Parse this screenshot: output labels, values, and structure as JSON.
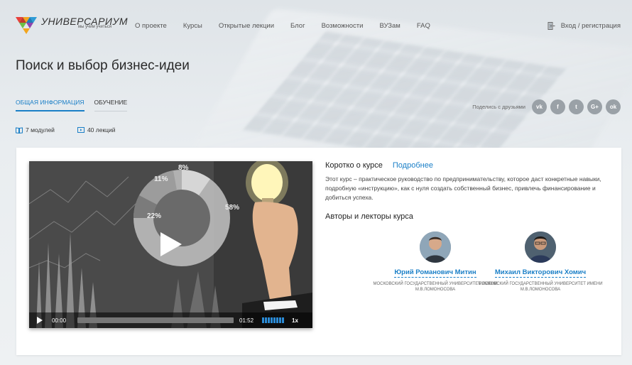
{
  "brand": {
    "name": "УНИВЕРСАРИУМ",
    "tagline": "мы учим учиться"
  },
  "nav": {
    "items": [
      "О проекте",
      "Курсы",
      "Открытые лекции",
      "Блог",
      "Возможности",
      "ВУЗам",
      "FAQ"
    ]
  },
  "login": {
    "label": "Вход / регистрация",
    "icon": "door-icon"
  },
  "page": {
    "title": "Поиск и выбор бизнес-идеи"
  },
  "tabs": [
    {
      "label": "Общая информация",
      "active": true
    },
    {
      "label": "Обучение",
      "active": false
    }
  ],
  "share": {
    "label": "Поделись с друзьями",
    "networks": [
      {
        "name": "vk-icon",
        "glyph": "vk"
      },
      {
        "name": "facebook-icon",
        "glyph": "f"
      },
      {
        "name": "twitter-icon",
        "glyph": "t"
      },
      {
        "name": "google-plus-icon",
        "glyph": "G+"
      },
      {
        "name": "odnoklassniki-icon",
        "glyph": "ok"
      }
    ]
  },
  "meta": {
    "modules": "7 модулей",
    "lectures": "40 лекций"
  },
  "video": {
    "current_time": "00:00",
    "duration": "01:52",
    "speed": "1x",
    "progress": 0,
    "volume_bars": 8,
    "pie_labels": [
      "8%",
      "11%",
      "22%",
      "58%"
    ]
  },
  "about": {
    "title": "Коротко о курсе",
    "more": "Подробнее",
    "description": "Этот курс – практическое руководство по предпринимательству, которое даст конкретные навыки, подробную «инструкцию», как с нуля создать собственный бизнес, привлечь финансирование и добиться успеха.",
    "authors_title": "Авторы и лекторы курса"
  },
  "lecturers": [
    {
      "name": "Юрий Романович Митин",
      "org": "Московский государственный университет имени М.В.Ломоносова"
    },
    {
      "name": "Михаил Викторович Хомич",
      "org": "Московский государственный университет имени М.В.Ломоносова"
    }
  ],
  "colors": {
    "accent": "#1a7fc7",
    "social": "#9aa1a7",
    "card": "#ffffff"
  }
}
